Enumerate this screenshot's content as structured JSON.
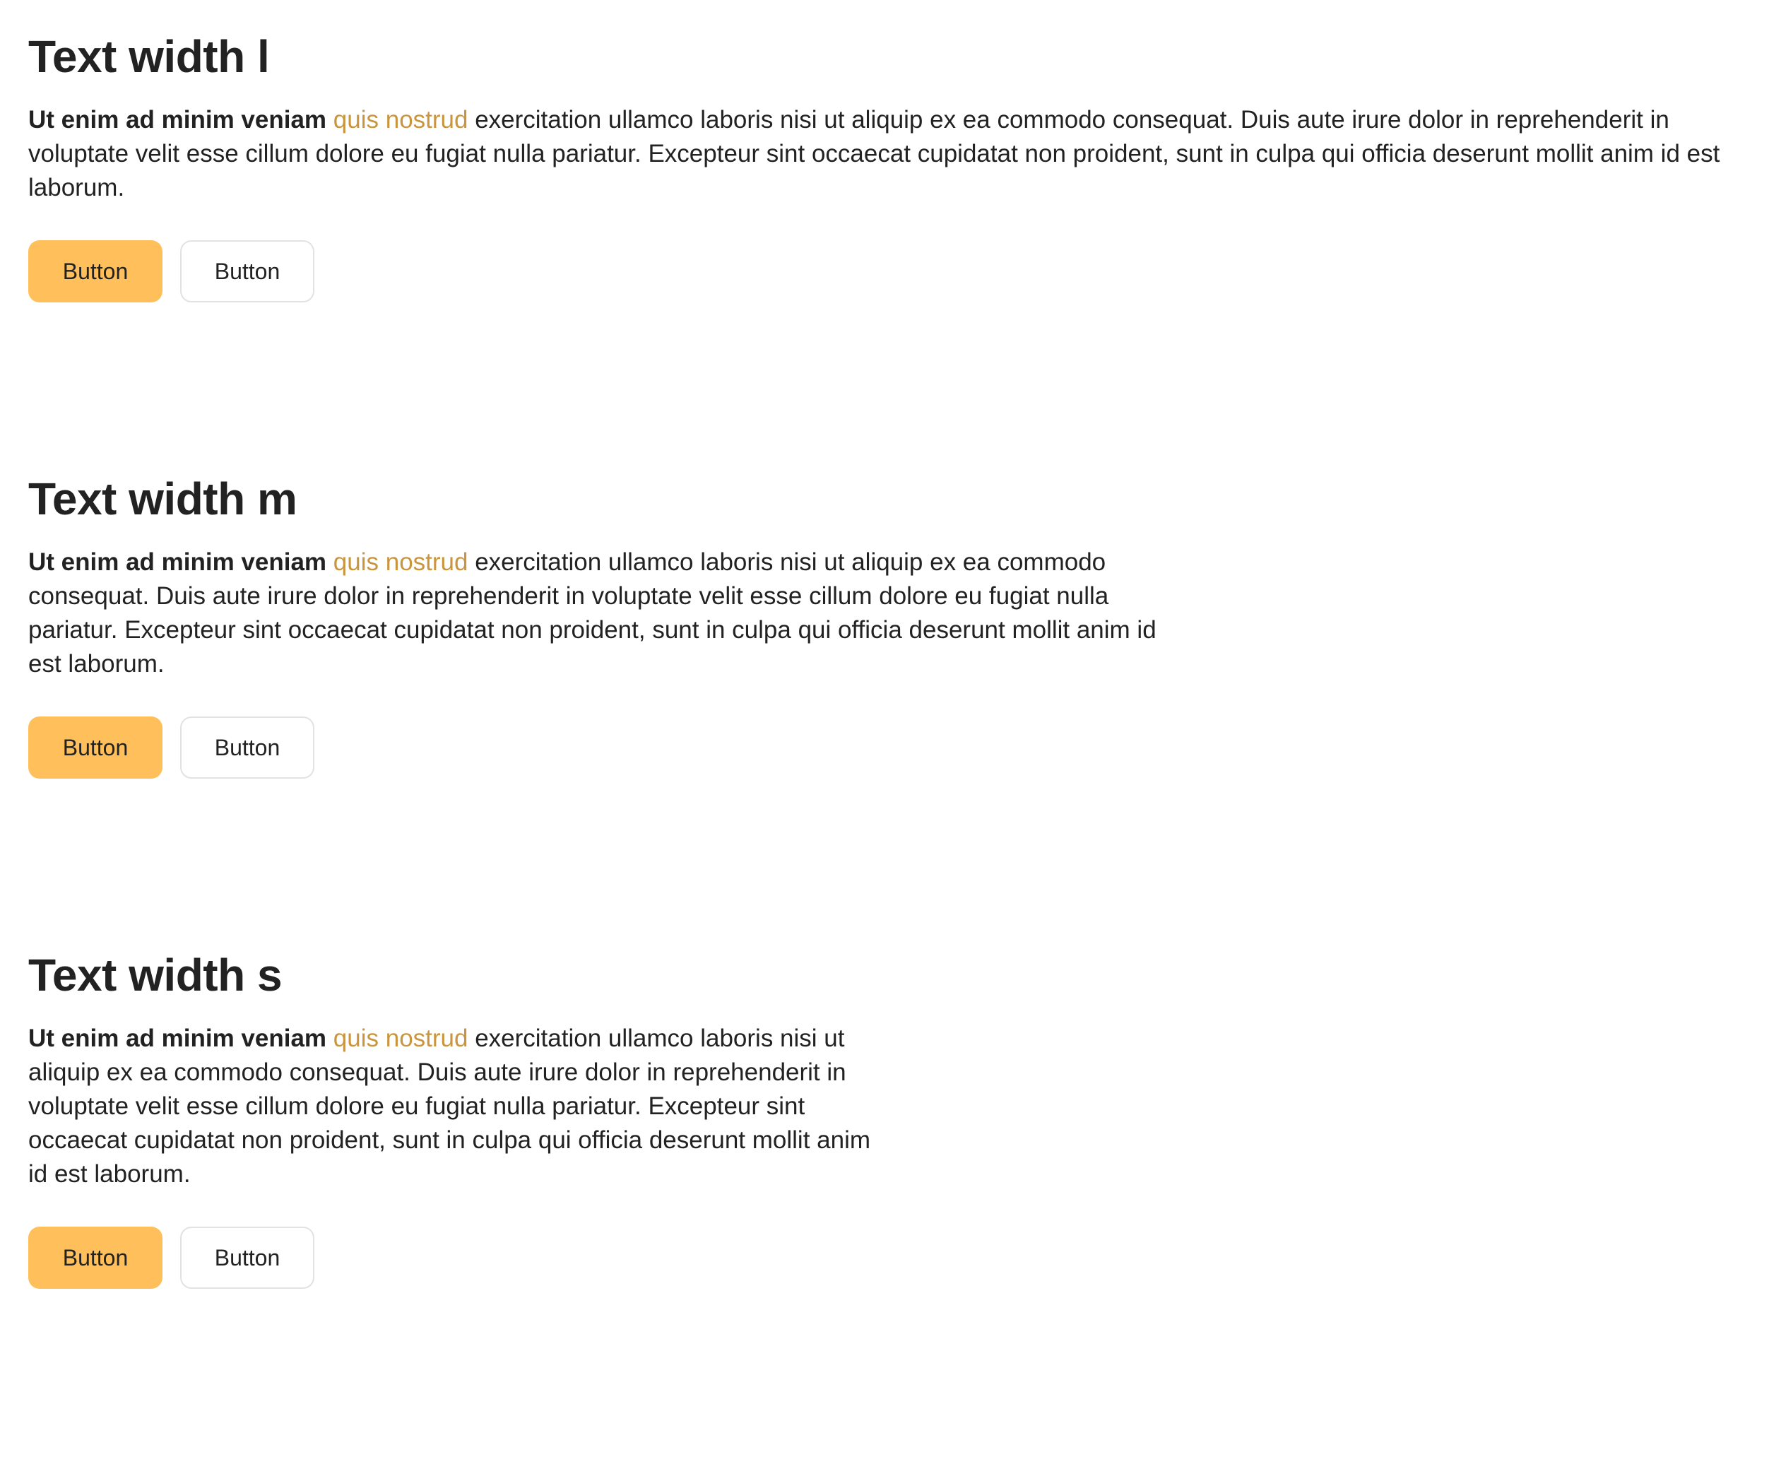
{
  "colors": {
    "accent_text": "#c9953e",
    "primary_button_bg": "#ffc05c"
  },
  "sections": [
    {
      "title": "Text width l",
      "lead": "Ut enim ad minim veniam",
      "link": "quis nostrud",
      "body": " exercitation ullamco laboris nisi ut aliquip ex ea commodo consequat. Duis aute irure dolor in reprehenderit in voluptate velit esse cillum dolore eu fugiat nulla pariatur. Excepteur sint occaecat cupidatat non proident, sunt in culpa qui officia deserunt mollit anim id est laborum.",
      "primary_button": "Button",
      "secondary_button": "Button"
    },
    {
      "title": "Text width m",
      "lead": "Ut enim ad minim veniam",
      "link": "quis nostrud",
      "body": " exercitation ullamco laboris nisi ut aliquip ex ea commodo consequat. Duis aute irure dolor in reprehenderit in voluptate velit esse cillum dolore eu fugiat nulla pariatur. Excepteur sint occaecat cupidatat non proident, sunt in culpa qui officia deserunt mollit anim id est laborum.",
      "primary_button": "Button",
      "secondary_button": "Button"
    },
    {
      "title": "Text width s",
      "lead": "Ut enim ad minim veniam",
      "link": "quis nostrud",
      "body": " exercitation ullamco laboris nisi ut aliquip ex ea commodo consequat. Duis aute irure dolor in reprehenderit in voluptate velit esse cillum dolore eu fugiat nulla pariatur. Excepteur sint occaecat cupidatat non proident, sunt in culpa qui officia deserunt mollit anim id est laborum.",
      "primary_button": "Button",
      "secondary_button": "Button"
    }
  ]
}
